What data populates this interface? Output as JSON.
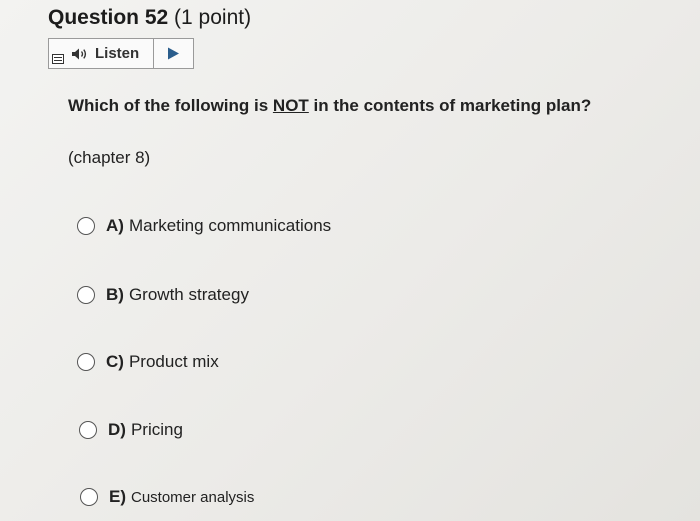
{
  "question_header": {
    "number_label": "Question 52",
    "points_label": "(1 point)"
  },
  "listen_toolbar": {
    "menu_icon": "menu-icon",
    "speaker_icon": "speaker-icon",
    "listen_label": "Listen",
    "play_icon": "play-icon"
  },
  "question": {
    "text_before": "Which of the following is ",
    "text_underlined": "NOT",
    "text_after": " in the contents of marketing plan?",
    "hint": "(chapter 8)"
  },
  "options": [
    {
      "letter": "A)",
      "text": "Marketing communications"
    },
    {
      "letter": "B)",
      "text": "Growth strategy"
    },
    {
      "letter": "C)",
      "text": "Product mix"
    },
    {
      "letter": "D)",
      "text": "Pricing"
    },
    {
      "letter": "E)",
      "text": "Customer analysis"
    }
  ]
}
